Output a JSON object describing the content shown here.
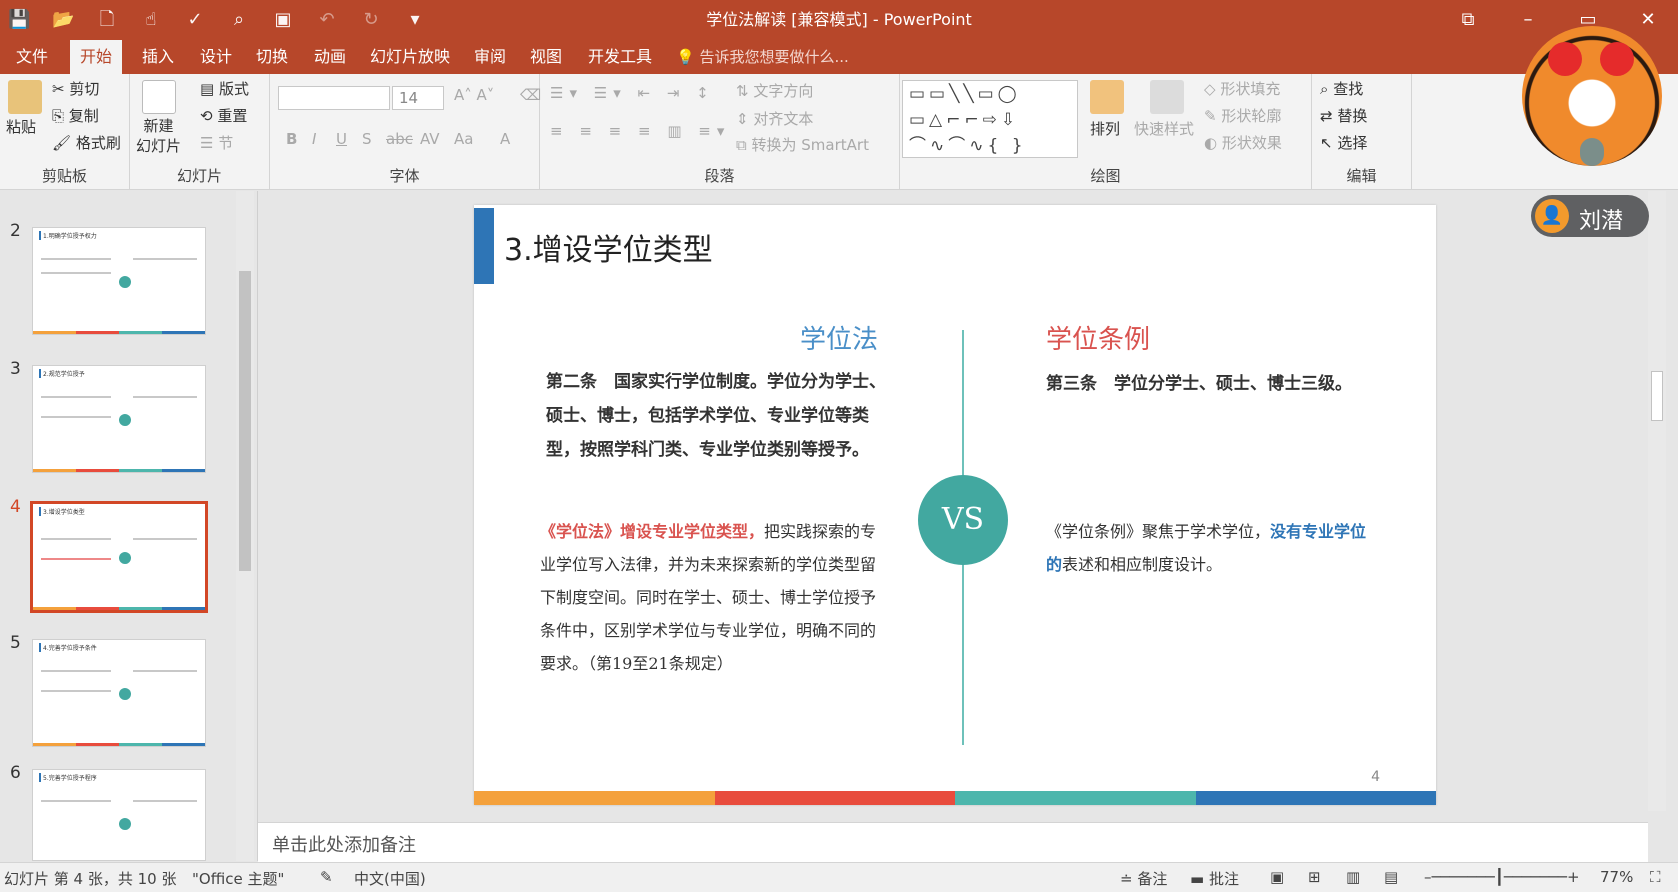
{
  "window": {
    "title": "学位法解读 [兼容模式] - PowerPoint",
    "controls": [
      "⧉",
      "–",
      "▭",
      "✕"
    ]
  },
  "qat": [
    "save-icon",
    "open-icon",
    "new-icon",
    "touch-mode-icon",
    "spellcheck-icon",
    "preview-icon",
    "present-icon",
    "undo-icon",
    "redo-icon",
    "customize-icon"
  ],
  "tabs": [
    "文件",
    "开始",
    "插入",
    "设计",
    "切换",
    "动画",
    "幻灯片放映",
    "审阅",
    "视图",
    "开发工具"
  ],
  "tell_me": "告诉我您想要做什么...",
  "ribbon": {
    "clipboard": {
      "paste": "粘贴",
      "cut": "剪切",
      "copy": "复制",
      "format_painter": "格式刷",
      "label": "剪贴板"
    },
    "slides": {
      "new_slide": "新建\n幻灯片",
      "layout": "版式",
      "reset": "重置",
      "section": "节",
      "label": "幻灯片"
    },
    "font": {
      "font_name": "",
      "font_size": "14",
      "label": "字体",
      "buttons": [
        "B",
        "I",
        "U",
        "S",
        "abc",
        "AV",
        "Aa",
        "A"
      ]
    },
    "paragraph": {
      "text_direction": "文字方向",
      "align_text": "对齐文本",
      "smartart": "转换为 SmartArt",
      "label": "段落"
    },
    "drawing": {
      "arrange": "排列",
      "quick_styles": "快速样式",
      "shape_fill": "形状填充",
      "shape_outline": "形状轮廓",
      "shape_effects": "形状效果",
      "label": "绘图"
    },
    "editing": {
      "find": "查找",
      "replace": "替换",
      "select": "选择",
      "label": "编辑"
    }
  },
  "thumbnails": [
    {
      "num": "2",
      "title": "1.明确学位授予权力"
    },
    {
      "num": "3",
      "title": "2.规范学位授予"
    },
    {
      "num": "4",
      "title": "3.增设学位类型"
    },
    {
      "num": "5",
      "title": "4.完善学位授予条件"
    },
    {
      "num": "6",
      "title": "5.完善学位授予程序"
    }
  ],
  "slide": {
    "title": "3.增设学位类型",
    "left_heading": "学位法",
    "right_heading": "学位条例",
    "left_article": "第二条　国家实行学位制度。学位分为学士、硕士、博士，包括学术学位、专业学位等类型，按照学科门类、专业学位类别等授予。",
    "left_exp_red": "《学位法》增设专业学位类型，",
    "left_exp_rest": "把实践探索的专业学位写入法律，并为未来探索新的学位类型留下制度空间。同时在学士、硕士、博士学位授予条件中，区别学术学位与专业学位，明确不同的要求。（第19至21条规定）",
    "right_article": "第三条　学位分学士、硕士、博士三级。",
    "right_exp_a": "《学位条例》聚焦于学术学位，",
    "right_exp_blue": "没有专业学位的",
    "right_exp_b": "表述和相应制度设计。",
    "vs": "VS",
    "page_number": "4",
    "bar_colors": [
      "#f4a13c",
      "#e84c3d",
      "#4db6ac",
      "#2e75b6"
    ]
  },
  "notes_placeholder": "单击此处添加备注",
  "status": {
    "slide_info": "幻灯片 第 4 张，共 10 张",
    "theme": "\"Office 主题\"",
    "language": "中文(中国)",
    "notes": "备注",
    "comments": "批注",
    "zoom": "77%"
  },
  "overlay": {
    "user_name": "刘潜"
  }
}
